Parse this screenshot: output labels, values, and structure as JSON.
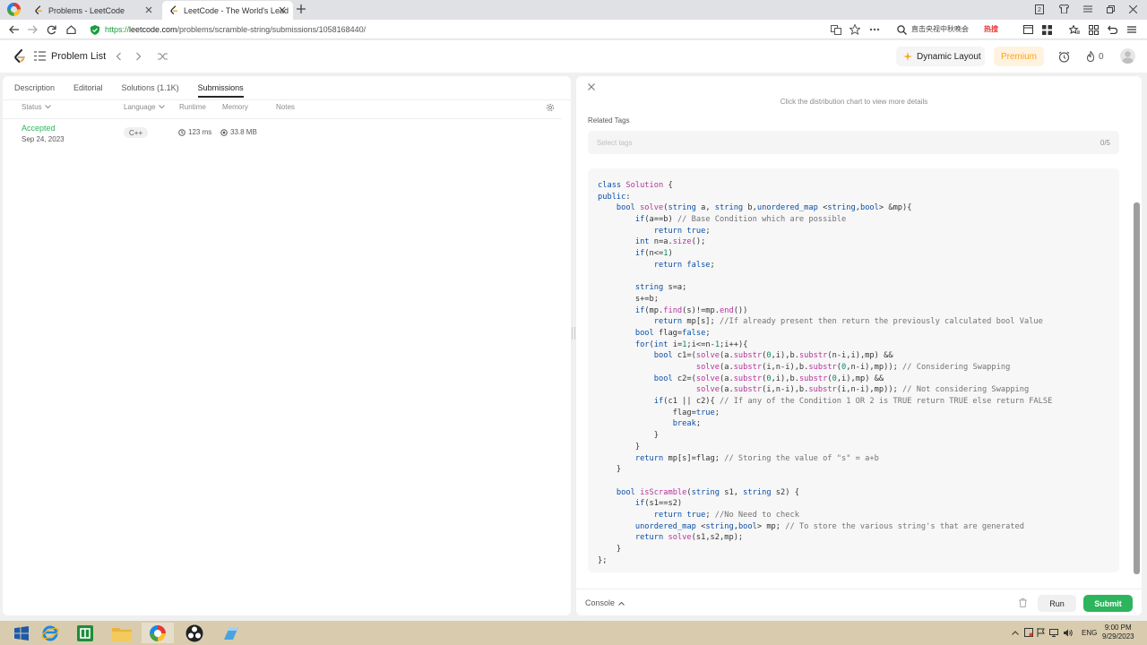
{
  "browser": {
    "tabs": [
      {
        "title": "Problems - LeetCode",
        "active": false
      },
      {
        "title": "LeetCode - The World's Lead",
        "active": true
      }
    ],
    "url": {
      "protocol": "https://",
      "host": "leetcode.com",
      "path": "/problems/scramble-string/submissions/1058168440/"
    },
    "search_hint": "直击央视中秋晚会",
    "hot_label": "热搜"
  },
  "header": {
    "problem_list": "Problem List",
    "dynamic_layout": "Dynamic Layout",
    "premium": "Premium",
    "streak_count": "0"
  },
  "left_panel": {
    "tabs": [
      {
        "label": "Description",
        "active": false
      },
      {
        "label": "Editorial",
        "active": false
      },
      {
        "label": "Solutions (1.1K)",
        "active": false
      },
      {
        "label": "Submissions",
        "active": true
      }
    ],
    "columns": {
      "status": "Status",
      "language": "Language",
      "runtime": "Runtime",
      "memory": "Memory",
      "notes": "Notes"
    },
    "submissions": [
      {
        "status": "Accepted",
        "date": "Sep 24, 2023",
        "language": "C++",
        "runtime": "123 ms",
        "memory": "33.8 MB"
      }
    ]
  },
  "right_panel": {
    "distribution_hint": "Click the distribution chart to view more details",
    "related_tags_label": "Related Tags",
    "tags_placeholder": "Select tags",
    "tags_count": "0/5",
    "code_lines": [
      "class Solution {",
      "public:",
      "    bool solve(string a, string b,unordered_map <string,bool> &mp){",
      "        if(a==b) // Base Condition which are possible",
      "            return true;",
      "        int n=a.size();",
      "        if(n<=1)",
      "            return false;",
      "",
      "        string s=a;",
      "        s+=b;",
      "        if(mp.find(s)!=mp.end())",
      "            return mp[s]; //If already present then return the previously calculated bool Value",
      "        bool flag=false;",
      "        for(int i=1;i<=n-1;i++){",
      "            bool c1=(solve(a.substr(0,i),b.substr(n-i,i),mp) &&",
      "                     solve(a.substr(i,n-i),b.substr(0,n-i),mp)); // Considering Swapping",
      "            bool c2=(solve(a.substr(0,i),b.substr(0,i),mp) &&",
      "                     solve(a.substr(i,n-i),b.substr(i,n-i),mp)); // Not considering Swapping",
      "            if(c1 || c2){ // If any of the Condition 1 OR 2 is TRUE return TRUE else return FALSE",
      "                flag=true;",
      "                break;",
      "            }",
      "        }",
      "        return mp[s]=flag; // Storing the value of \"s\" = a+b",
      "    }",
      "",
      "    bool isScramble(string s1, string s2) {",
      "        if(s1==s2)",
      "            return true; //No Need to check",
      "        unordered_map <string,bool> mp; // To store the various string's that are generated",
      "        return solve(s1,s2,mp);",
      "    }",
      "};"
    ],
    "console_label": "Console",
    "run_label": "Run",
    "submit_label": "Submit"
  },
  "taskbar": {
    "lang": "ENG",
    "time": "9:00 PM",
    "date": "9/29/2023"
  },
  "colors": {
    "accent_green": "#2db55d",
    "premium_orange": "#ffa116",
    "taskbar": "#d9ccae"
  }
}
